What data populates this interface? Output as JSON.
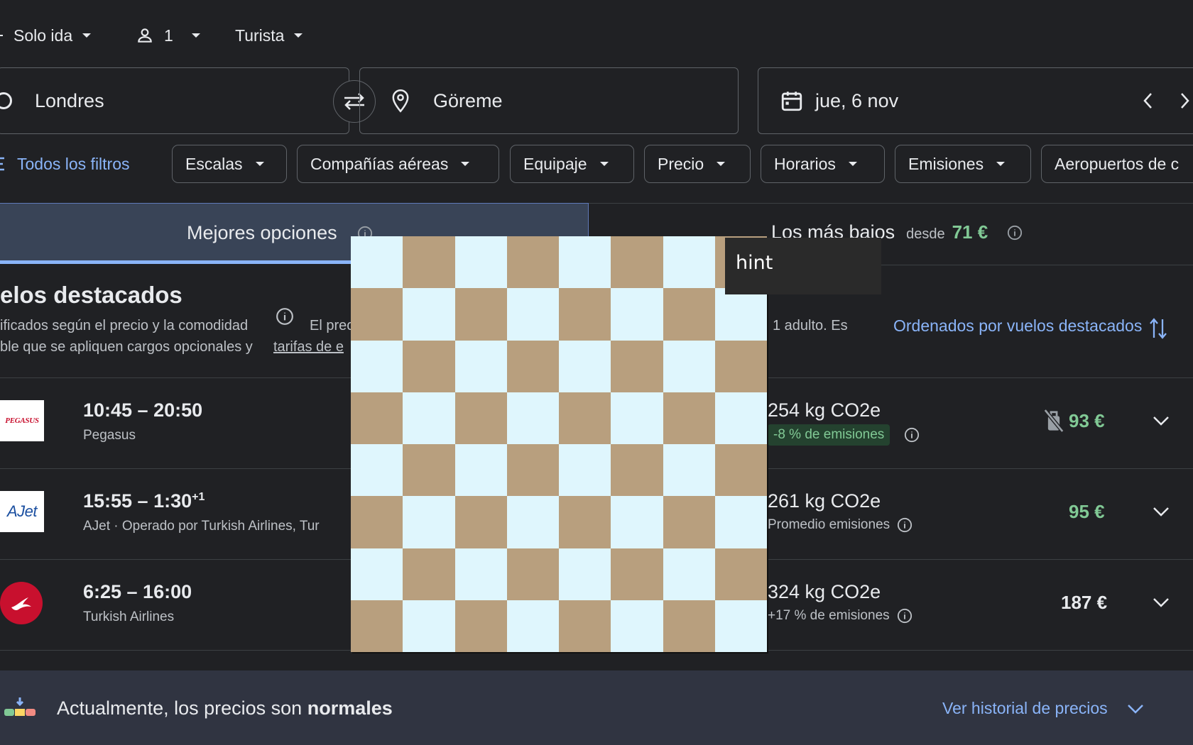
{
  "top_bar": {
    "trip_type": "Solo ida",
    "passengers": "1",
    "cabin_class": "Turista"
  },
  "search": {
    "origin": "Londres",
    "destination": "Göreme",
    "date": "jue, 6 nov"
  },
  "filters": {
    "all_filters": "Todos los filtros",
    "chips": [
      "Escalas",
      "Compañías aéreas",
      "Equipaje",
      "Precio",
      "Horarios",
      "Emisiones",
      "Aeropuertos de c"
    ]
  },
  "tabs": {
    "best": "Mejores opciones",
    "cheapest": "Los más bajos",
    "cheapest_from": "desde",
    "cheapest_price": "71 €"
  },
  "results": {
    "heading": "elos destacados",
    "subtitle_line1_a": "ificados según el precio y la comodidad",
    "subtitle_line1_b": "El prec",
    "subtitle_line1_c": "1 adulto. Es",
    "subtitle_line2_a": "ble que se apliquen cargos opcionales y",
    "subtitle_line2_link": "tarifas de e",
    "sort_label": "Ordenados por vuelos destacados"
  },
  "flights": [
    {
      "logo": "PEGASUS",
      "times": "10:45 – 20:50",
      "times_sup": "",
      "airline": "Pegasus",
      "co2": "254 kg CO2e",
      "emissions": "-8 % de emisiones",
      "price": "93 €"
    },
    {
      "logo": "AJet",
      "times": "15:55 – 1:30",
      "times_sup": "+1",
      "airline": "AJet · Operado por Turkish Airlines, Tur",
      "co2": "261 kg CO2e",
      "emissions": "Promedio emisiones",
      "price": "95 €"
    },
    {
      "logo": "",
      "times": "6:25 – 16:00",
      "times_sup": "",
      "airline": "Turkish Airlines",
      "co2": "324 kg CO2e",
      "emissions": "+17 % de emisiones",
      "price": "187 €"
    }
  ],
  "price_insight": {
    "text": "Actualmente, los precios son",
    "text_bold": "normales",
    "link": "Ver historial de precios"
  },
  "overlay": {
    "hint": "hint"
  },
  "colors": {
    "background": "#202124",
    "accent_blue": "#8ab4f8",
    "price_green": "#81c995",
    "checker_tan": "#b89f7e",
    "checker_light": "#dff6fd"
  }
}
